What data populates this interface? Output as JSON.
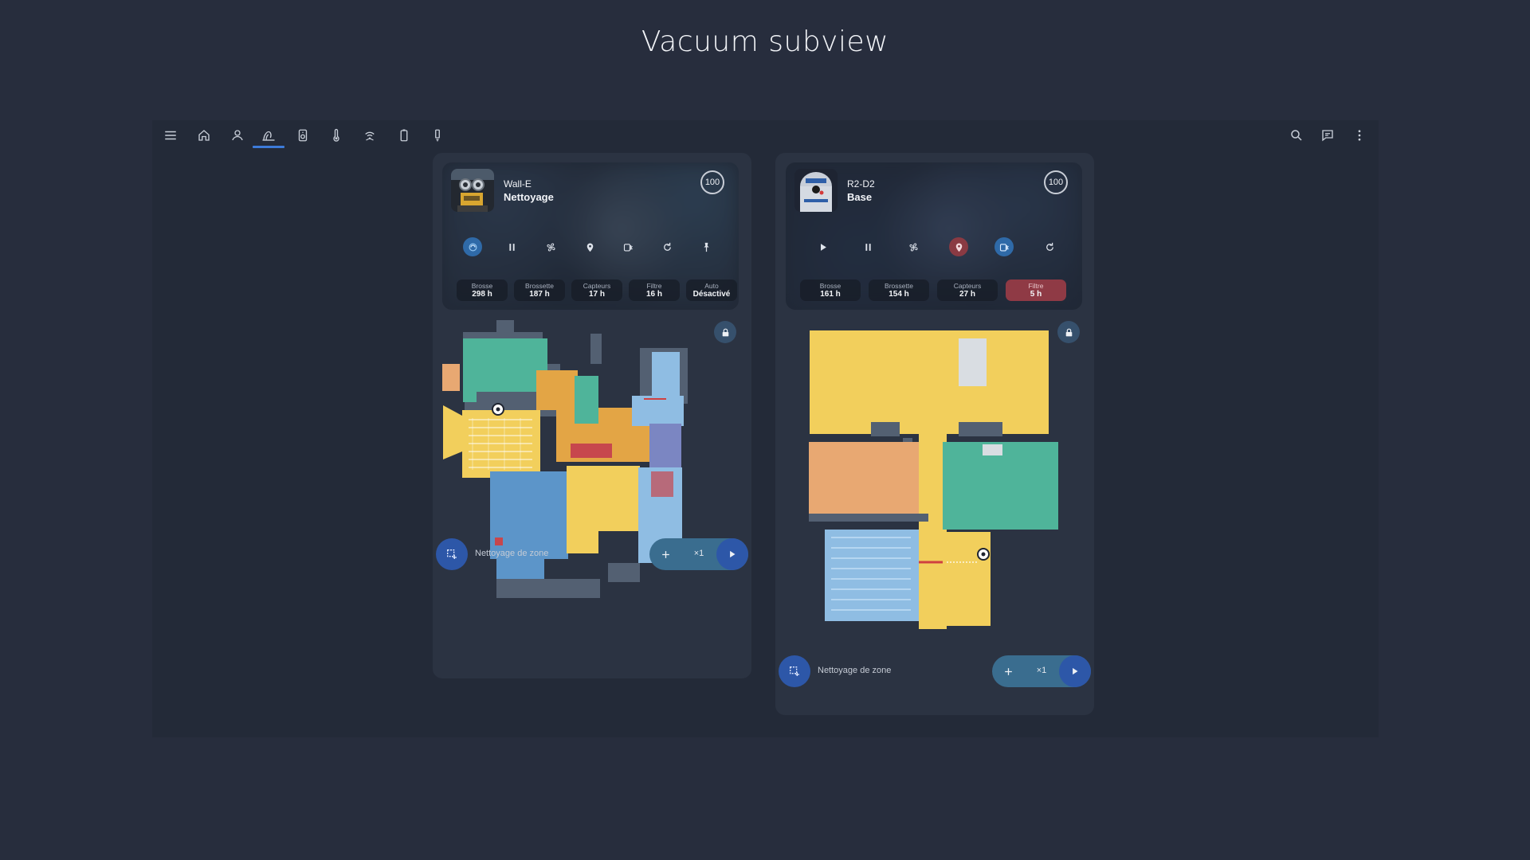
{
  "page": {
    "title": "Vacuum subview"
  },
  "toolbar": {
    "left_icons": [
      "menu-icon",
      "home-icon",
      "person-icon",
      "robot-vacuum-icon",
      "speaker-icon",
      "thermometer-icon",
      "wifi-icon",
      "battery-icon",
      "light-bulb-icon"
    ],
    "active_index": 3,
    "right_icons": [
      "search-icon",
      "chat-icon",
      "more-vert-icon"
    ]
  },
  "cards": [
    {
      "robot": {
        "name": "Wall-E",
        "status": "Nettoyage",
        "battery": "100"
      },
      "controls": [
        "clean-active-icon",
        "pause-icon",
        "fan-icon",
        "locate-icon",
        "dock-icon",
        "refresh-icon",
        "pin-icon"
      ],
      "stats": [
        {
          "label": "Brosse",
          "value": "298 h",
          "warn": false
        },
        {
          "label": "Brossette",
          "value": "187 h",
          "warn": false
        },
        {
          "label": "Capteurs",
          "value": "17 h",
          "warn": false
        },
        {
          "label": "Filtre",
          "value": "16 h",
          "warn": false
        },
        {
          "label": "Auto",
          "value": "Désactivé",
          "warn": false
        }
      ],
      "zone_label": "Nettoyage de zone",
      "repeat": "×1"
    },
    {
      "robot": {
        "name": "R2-D2",
        "status": "Base",
        "battery": "100"
      },
      "controls": [
        "play-icon",
        "pause-icon",
        "fan-icon",
        "locate-icon",
        "dock-icon",
        "refresh-icon"
      ],
      "stats": [
        {
          "label": "Brosse",
          "value": "161 h",
          "warn": false
        },
        {
          "label": "Brossette",
          "value": "154 h",
          "warn": false
        },
        {
          "label": "Capteurs",
          "value": "27 h",
          "warn": false
        },
        {
          "label": "Filtre",
          "value": "5 h",
          "warn": true
        }
      ],
      "zone_label": "Nettoyage de zone",
      "repeat": "×1"
    }
  ],
  "colors": {
    "background": "#272d3d",
    "accent": "#3d7bd9",
    "zone_button": "#2d57a8",
    "room_teal": "#4fb49a",
    "room_yellow": "#f2cf5c",
    "room_orange": "#e3a545",
    "room_blue": "#5c95c9",
    "room_lightblue": "#8fbde3",
    "room_peach": "#e8a872",
    "room_purple": "#7b86c2",
    "warn": "#8f3a45"
  }
}
